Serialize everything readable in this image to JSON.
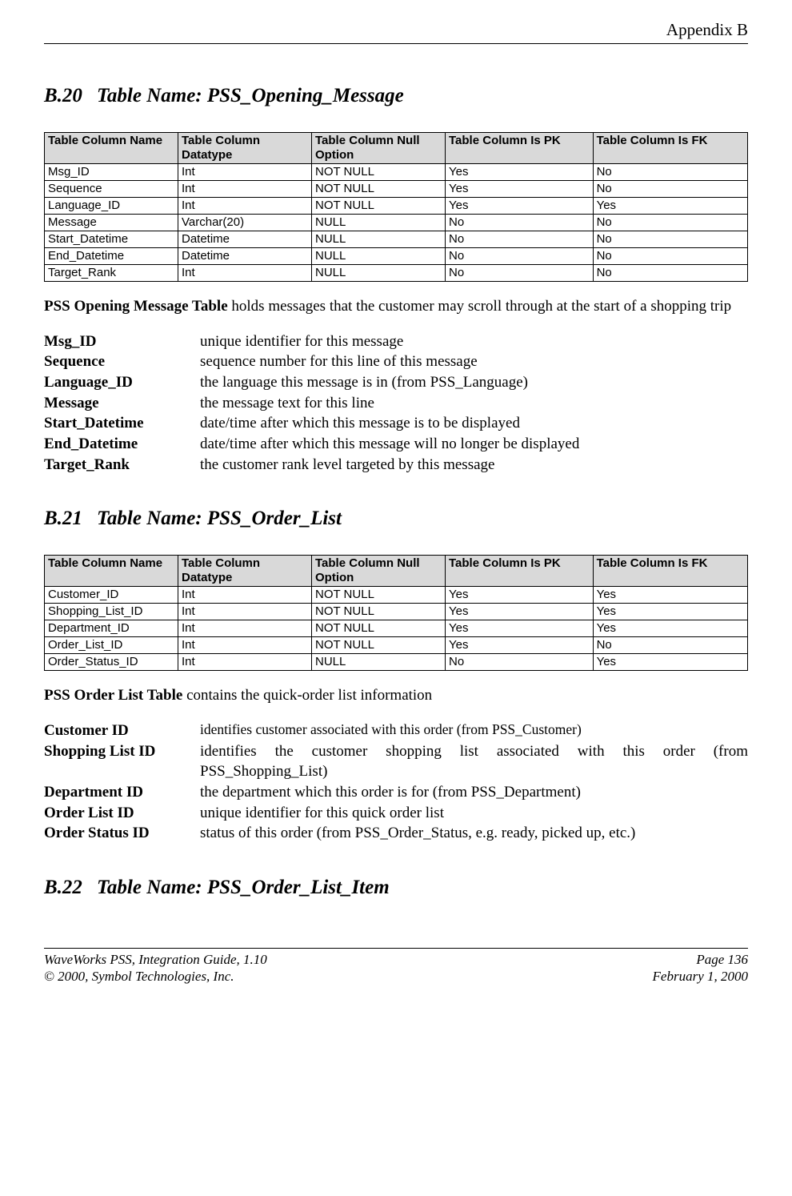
{
  "header": {
    "label": "Appendix B"
  },
  "section_b20": {
    "num": "B.20",
    "title": "Table Name: PSS_Opening_Message",
    "table_headers": {
      "c1": "Table Column Name",
      "c2": "Table Column Datatype",
      "c3": "Table Column Null Option",
      "c4": "Table Column Is PK",
      "c5": "Table Column Is FK"
    },
    "rows": [
      {
        "c1": "Msg_ID",
        "c2": "Int",
        "c3": "NOT NULL",
        "c4": "Yes",
        "c5": "No"
      },
      {
        "c1": "Sequence",
        "c2": "Int",
        "c3": "NOT NULL",
        "c4": "Yes",
        "c5": "No"
      },
      {
        "c1": "Language_ID",
        "c2": "Int",
        "c3": "NOT NULL",
        "c4": "Yes",
        "c5": "Yes"
      },
      {
        "c1": "Message",
        "c2": "Varchar(20)",
        "c3": "NULL",
        "c4": "No",
        "c5": "No"
      },
      {
        "c1": "Start_Datetime",
        "c2": "Datetime",
        "c3": "NULL",
        "c4": "No",
        "c5": "No"
      },
      {
        "c1": "End_Datetime",
        "c2": "Datetime",
        "c3": "NULL",
        "c4": "No",
        "c5": "No"
      },
      {
        "c1": "Target_Rank",
        "c2": "Int",
        "c3": "NULL",
        "c4": "No",
        "c5": "No"
      }
    ],
    "desc_lead": "PSS Opening Message Table",
    "desc_rest": " holds messages that the customer may scroll through at the start of a shopping trip",
    "fields": [
      {
        "term": "Msg_ID",
        "def": "unique identifier for this message"
      },
      {
        "term": "Sequence",
        "def": "sequence number for this line of this message"
      },
      {
        "term": "Language_ID",
        "def": "the language this message is in (from PSS_Language)"
      },
      {
        "term": "Message",
        "def": "the message text for this line"
      },
      {
        "term": "Start_Datetime",
        "def": "date/time after which this message is to be displayed"
      },
      {
        "term": "End_Datetime",
        "def": "date/time after which this message will no longer be displayed"
      },
      {
        "term": "Target_Rank",
        "def": "the customer rank level targeted by this message"
      }
    ]
  },
  "section_b21": {
    "num": "B.21",
    "title": "Table Name: PSS_Order_List",
    "table_headers": {
      "c1": "Table Column Name",
      "c2": "Table Column Datatype",
      "c3": "Table Column Null Option",
      "c4": "Table Column Is PK",
      "c5": "Table Column Is FK"
    },
    "rows": [
      {
        "c1": "Customer_ID",
        "c2": "Int",
        "c3": "NOT NULL",
        "c4": "Yes",
        "c5": "Yes"
      },
      {
        "c1": "Shopping_List_ID",
        "c2": "Int",
        "c3": "NOT NULL",
        "c4": "Yes",
        "c5": "Yes"
      },
      {
        "c1": "Department_ID",
        "c2": "Int",
        "c3": "NOT NULL",
        "c4": "Yes",
        "c5": "Yes"
      },
      {
        "c1": "Order_List_ID",
        "c2": "Int",
        "c3": "NOT NULL",
        "c4": "Yes",
        "c5": "No"
      },
      {
        "c1": "Order_Status_ID",
        "c2": "Int",
        "c3": "NULL",
        "c4": "No",
        "c5": "Yes"
      }
    ],
    "desc_lead": "PSS Order List Table",
    "desc_rest": " contains the quick-order list information",
    "fields": [
      {
        "term": "Customer ID",
        "def": "identifies customer associated with this order (from PSS_Customer)",
        "small": true
      },
      {
        "term": "Shopping List ID",
        "def": "identifies the customer shopping list associated with this order (from PSS_Shopping_List)"
      },
      {
        "term": "Department ID",
        "def": "the department which this order is for (from PSS_Department)"
      },
      {
        "term": "Order List ID",
        "def": "unique identifier for this quick order list"
      },
      {
        "term": "Order Status ID",
        "def": "status of this order (from PSS_Order_Status, e.g. ready, picked up, etc.)"
      }
    ]
  },
  "section_b22": {
    "num": "B.22",
    "title": "Table Name: PSS_Order_List_Item"
  },
  "footer": {
    "l1_left": "WaveWorks PSS, Integration Guide, 1.10",
    "l1_right": "Page 136",
    "l2_left": "© 2000, Symbol Technologies, Inc.",
    "l2_right": "February 1, 2000"
  }
}
